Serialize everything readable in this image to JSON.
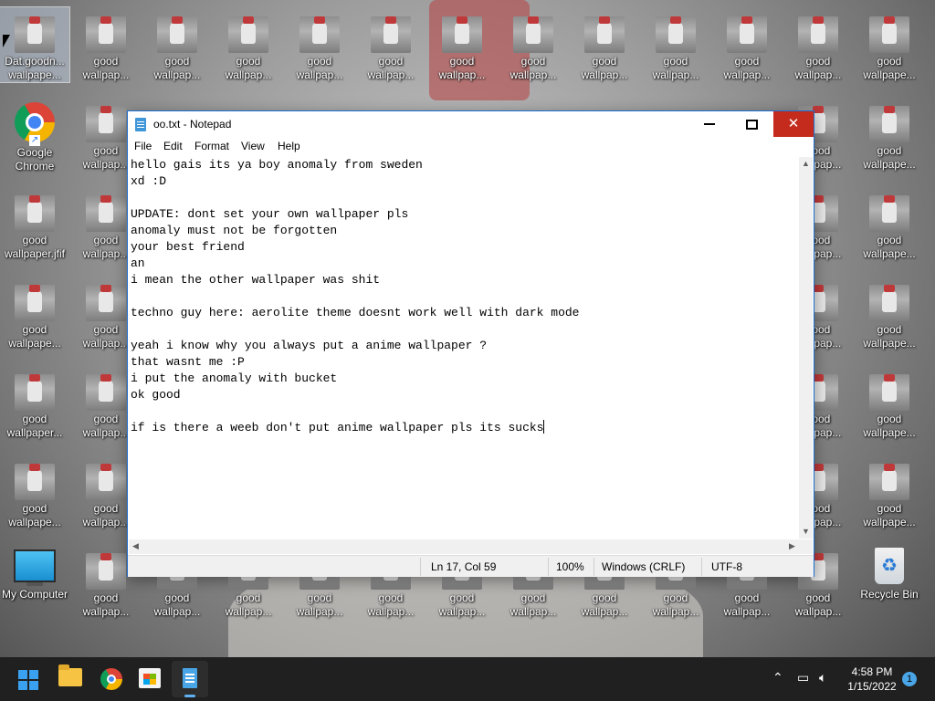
{
  "desktop": {
    "icons": [
      {
        "label": "Dat.goodn...\nwallpape...",
        "type": "image"
      },
      {
        "label": "good\nwallpap...",
        "type": "image"
      },
      {
        "label": "good\nwallpap...",
        "type": "image"
      },
      {
        "label": "good\nwallpap...",
        "type": "image"
      },
      {
        "label": "good\nwallpap...",
        "type": "image"
      },
      {
        "label": "good\nwallpap...",
        "type": "image"
      },
      {
        "label": "good\nwallpap...",
        "type": "image"
      },
      {
        "label": "good\nwallpap...",
        "type": "image"
      },
      {
        "label": "good\nwallpap...",
        "type": "image"
      },
      {
        "label": "good\nwallpap...",
        "type": "image"
      },
      {
        "label": "good\nwallpap...",
        "type": "image"
      },
      {
        "label": "good\nwallpap...",
        "type": "image"
      },
      {
        "label": "good\nwallpape...",
        "type": "image"
      },
      {
        "label": "Google\nChrome",
        "type": "chrome"
      },
      {
        "label": "good\nwallpap...",
        "type": "image"
      },
      {
        "label": "good\nwallpap...",
        "type": "image"
      },
      {
        "label": "good\nwallpape...",
        "type": "image"
      },
      {
        "label": "good\nwallpaper.jfif",
        "type": "image"
      },
      {
        "label": "good\nwallpap...",
        "type": "image"
      },
      {
        "label": "good\nwallpap...",
        "type": "image"
      },
      {
        "label": "good\nwallpape...",
        "type": "image"
      },
      {
        "label": "good\nwallpape...",
        "type": "image"
      },
      {
        "label": "good\nwallpap...",
        "type": "image"
      },
      {
        "label": "good\nwallpap...",
        "type": "image"
      },
      {
        "label": "good\nwallpape...",
        "type": "image"
      },
      {
        "label": "good\nwallpaper...",
        "type": "image"
      },
      {
        "label": "good\nwallpap...",
        "type": "image"
      },
      {
        "label": "good\nwallpap...",
        "type": "image"
      },
      {
        "label": "good\nwallpape...",
        "type": "image"
      },
      {
        "label": "good\nwallpape...",
        "type": "image"
      },
      {
        "label": "good\nwallpap...",
        "type": "image"
      },
      {
        "label": "good\nwallpap...",
        "type": "image"
      },
      {
        "label": "good\nwallpape...",
        "type": "image"
      },
      {
        "label": "My Computer",
        "type": "computer"
      },
      {
        "label": "good\nwallpap...",
        "type": "image"
      },
      {
        "label": "good\nwallpap...",
        "type": "image"
      },
      {
        "label": "good\nwallpap...",
        "type": "image"
      },
      {
        "label": "good\nwallpap...",
        "type": "image"
      },
      {
        "label": "good\nwallpap...",
        "type": "image"
      },
      {
        "label": "good\nwallpap...",
        "type": "image"
      },
      {
        "label": "good\nwallpap...",
        "type": "image"
      },
      {
        "label": "good\nwallpap...",
        "type": "image"
      },
      {
        "label": "good\nwallpap...",
        "type": "image"
      },
      {
        "label": "good\nwallpap...",
        "type": "image"
      },
      {
        "label": "good\nwallpap...",
        "type": "image"
      },
      {
        "label": "Recycle Bin",
        "type": "bin"
      }
    ]
  },
  "notepad": {
    "title": "oo.txt - Notepad",
    "menu": [
      "File",
      "Edit",
      "Format",
      "View",
      "Help"
    ],
    "content": "hello gais its ya boy anomaly from sweden\nxd :D\n\nUPDATE: dont set your own wallpaper pls\nanomaly must not be forgotten\nyour best friend\nan\ni mean the other wallpaper was shit\n\ntechno guy here: aerolite theme doesnt work well with dark mode\n\nyeah i know why you always put a anime wallpaper ?\nthat wasnt me :P\ni put the anomaly with bucket\nok good\n\nif is there a weeb don't put anime wallpaper pls its sucks",
    "status": {
      "position": "Ln 17, Col 59",
      "zoom": "100%",
      "line_ending": "Windows (CRLF)",
      "encoding": "UTF-8"
    }
  },
  "taskbar": {
    "time": "4:58 PM",
    "date": "1/15/2022",
    "notification_count": "1",
    "accent": "#60b0f4"
  }
}
